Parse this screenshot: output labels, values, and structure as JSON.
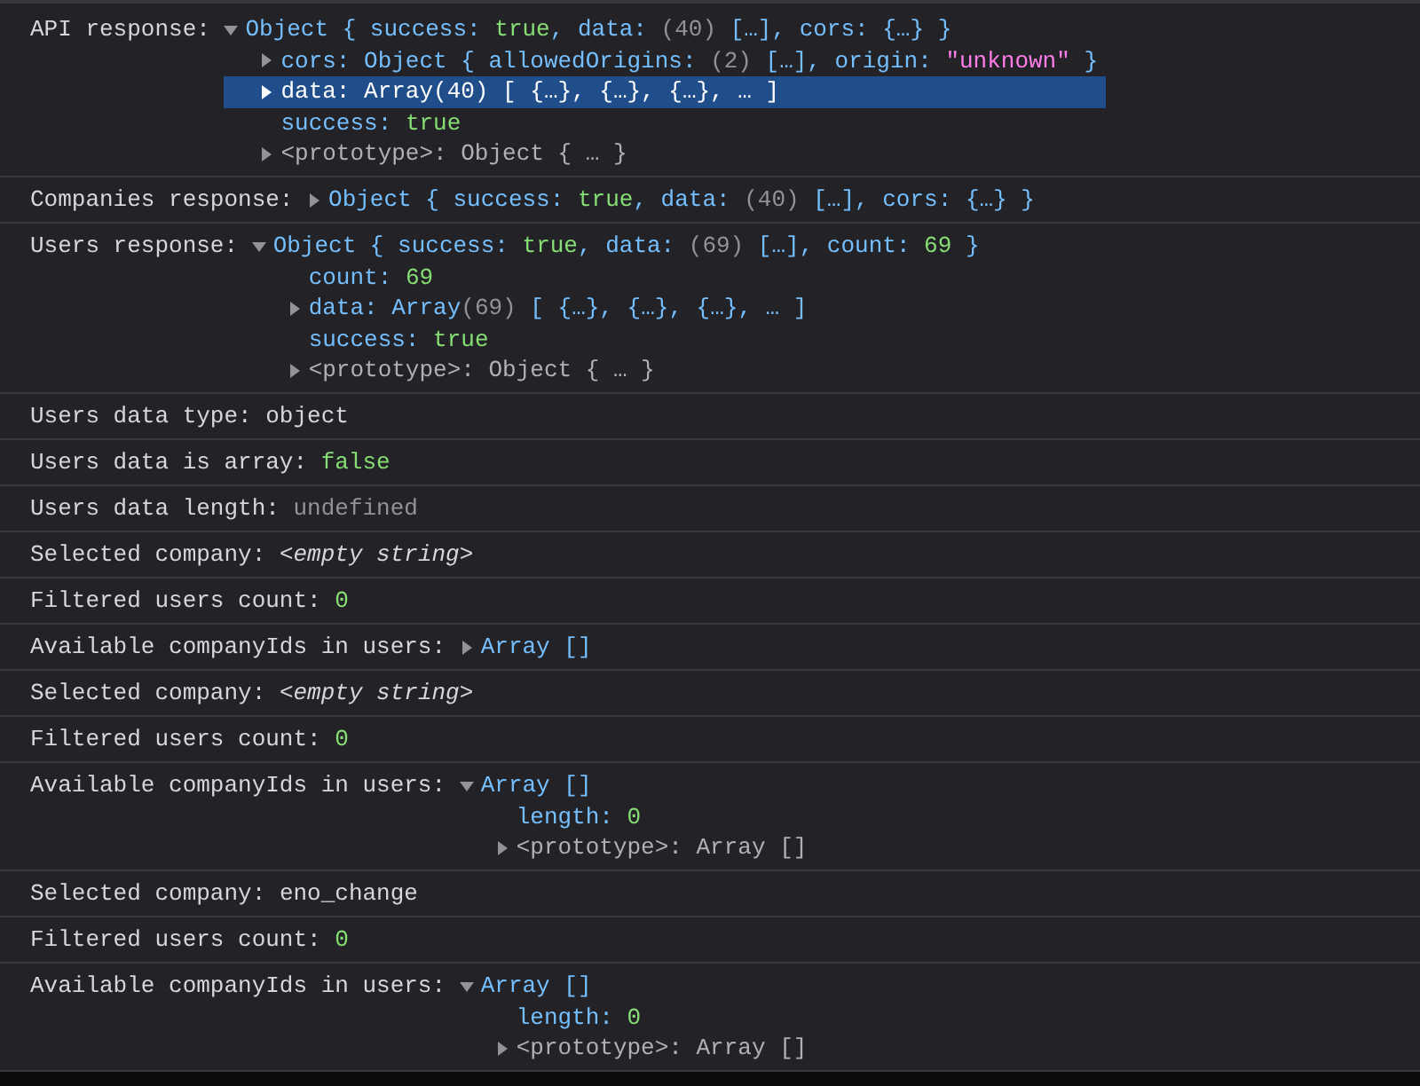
{
  "messages": [
    {
      "kind": "tree",
      "label": "API response:",
      "expanded": true,
      "summary": [
        {
          "kind": "name",
          "text": "Object { success: "
        },
        {
          "kind": "bool",
          "text": "true"
        },
        {
          "kind": "name",
          "text": ", data: "
        },
        {
          "kind": "count",
          "text": "(40)"
        },
        {
          "kind": "name",
          "text": " […], cors: {…} }"
        }
      ],
      "children": [
        {
          "expandable": true,
          "expanded": false,
          "selected": false,
          "tokens": [
            {
              "kind": "name",
              "text": "cors: Object { allowedOrigins: "
            },
            {
              "kind": "count",
              "text": "(2)"
            },
            {
              "kind": "name",
              "text": " […], origin: "
            },
            {
              "kind": "str",
              "text": "\"unknown\""
            },
            {
              "kind": "name",
              "text": " }"
            }
          ]
        },
        {
          "expandable": true,
          "expanded": false,
          "selected": true,
          "tokens": [
            {
              "kind": "name",
              "text": "data: Array(40) [ {…}, {…}, {…}, … ]"
            }
          ]
        },
        {
          "expandable": false,
          "selected": false,
          "tokens": [
            {
              "kind": "name",
              "text": "success: "
            },
            {
              "kind": "bool",
              "text": "true"
            }
          ]
        },
        {
          "expandable": true,
          "expanded": false,
          "selected": false,
          "tokens": [
            {
              "kind": "muted",
              "text": "<prototype>: Object { … }"
            }
          ]
        }
      ]
    },
    {
      "kind": "tree",
      "label": "Companies response:",
      "expanded": false,
      "summary": [
        {
          "kind": "name",
          "text": "Object { success: "
        },
        {
          "kind": "bool",
          "text": "true"
        },
        {
          "kind": "name",
          "text": ", data: "
        },
        {
          "kind": "count",
          "text": "(40)"
        },
        {
          "kind": "name",
          "text": " […], cors: {…} }"
        }
      ]
    },
    {
      "kind": "tree",
      "label": "Users response:",
      "expanded": true,
      "summary": [
        {
          "kind": "name",
          "text": "Object { success: "
        },
        {
          "kind": "bool",
          "text": "true"
        },
        {
          "kind": "name",
          "text": ", data: "
        },
        {
          "kind": "count",
          "text": "(69)"
        },
        {
          "kind": "name",
          "text": " […], count: "
        },
        {
          "kind": "num",
          "text": "69"
        },
        {
          "kind": "name",
          "text": " }"
        }
      ],
      "children": [
        {
          "expandable": false,
          "selected": false,
          "tokens": [
            {
              "kind": "name",
              "text": "count: "
            },
            {
              "kind": "num",
              "text": "69"
            }
          ]
        },
        {
          "expandable": true,
          "expanded": false,
          "selected": false,
          "tokens": [
            {
              "kind": "name",
              "text": "data: Array"
            },
            {
              "kind": "count",
              "text": "(69)"
            },
            {
              "kind": "name",
              "text": " [ {…}, {…}, {…}, … ]"
            }
          ]
        },
        {
          "expandable": false,
          "selected": false,
          "tokens": [
            {
              "kind": "name",
              "text": "success: "
            },
            {
              "kind": "bool",
              "text": "true"
            }
          ]
        },
        {
          "expandable": true,
          "expanded": false,
          "selected": false,
          "tokens": [
            {
              "kind": "muted",
              "text": "<prototype>: Object { … }"
            }
          ]
        }
      ]
    },
    {
      "kind": "text",
      "label": "Users data type:",
      "value": [
        {
          "kind": "plain",
          "text": "object"
        }
      ]
    },
    {
      "kind": "text",
      "label": "Users data is array:",
      "value": [
        {
          "kind": "bool",
          "text": "false"
        }
      ]
    },
    {
      "kind": "text",
      "label": "Users data length:",
      "value": [
        {
          "kind": "undef",
          "text": "undefined"
        }
      ]
    },
    {
      "kind": "text",
      "label": "Selected company:",
      "value": [
        {
          "kind": "italic",
          "text": "<empty string>"
        }
      ]
    },
    {
      "kind": "text",
      "label": "Filtered users count:",
      "value": [
        {
          "kind": "num",
          "text": "0"
        }
      ]
    },
    {
      "kind": "tree",
      "label": "Available companyIds in users:",
      "expanded": false,
      "summary": [
        {
          "kind": "name",
          "text": "Array []"
        }
      ]
    },
    {
      "kind": "text",
      "label": "Selected company:",
      "value": [
        {
          "kind": "italic",
          "text": "<empty string>"
        }
      ]
    },
    {
      "kind": "text",
      "label": "Filtered users count:",
      "value": [
        {
          "kind": "num",
          "text": "0"
        }
      ]
    },
    {
      "kind": "tree",
      "label": "Available companyIds in users:",
      "expanded": true,
      "summary": [
        {
          "kind": "name",
          "text": "Array []"
        }
      ],
      "children": [
        {
          "expandable": false,
          "selected": false,
          "tokens": [
            {
              "kind": "name",
              "text": "length: "
            },
            {
              "kind": "num",
              "text": "0"
            }
          ]
        },
        {
          "expandable": true,
          "expanded": false,
          "selected": false,
          "tokens": [
            {
              "kind": "muted",
              "text": "<prototype>: Array []"
            }
          ]
        }
      ]
    },
    {
      "kind": "text",
      "label": "Selected company:",
      "value": [
        {
          "kind": "plain",
          "text": "eno_change"
        }
      ]
    },
    {
      "kind": "text",
      "label": "Filtered users count:",
      "value": [
        {
          "kind": "num",
          "text": "0"
        }
      ]
    },
    {
      "kind": "tree",
      "label": "Available companyIds in users:",
      "expanded": true,
      "summary": [
        {
          "kind": "name",
          "text": "Array []"
        }
      ],
      "children": [
        {
          "expandable": false,
          "selected": false,
          "tokens": [
            {
              "kind": "name",
              "text": "length: "
            },
            {
              "kind": "num",
              "text": "0"
            }
          ]
        },
        {
          "expandable": true,
          "expanded": false,
          "selected": false,
          "tokens": [
            {
              "kind": "muted",
              "text": "<prototype>: Array []"
            }
          ]
        }
      ]
    }
  ]
}
